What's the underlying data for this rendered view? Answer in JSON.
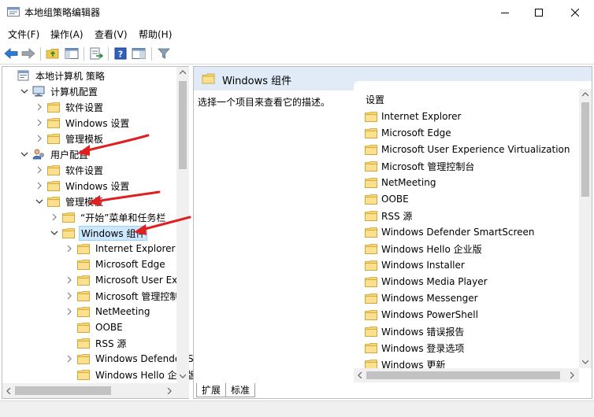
{
  "window": {
    "title": "本地组策略编辑器",
    "minimize_label": "minimize",
    "maximize_label": "maximize",
    "close_label": "close"
  },
  "menu": {
    "items": [
      "文件(F)",
      "操作(A)",
      "查看(V)",
      "帮助(H)"
    ]
  },
  "toolbar": {
    "icons": [
      "back-arrow-icon",
      "forward-arrow-icon",
      "up-folder-icon",
      "show-hide-tree-icon",
      "export-list-icon",
      "help-icon",
      "properties-pane-icon",
      "filter-icon"
    ]
  },
  "tree": {
    "items": [
      {
        "label": "本地计算机 策略",
        "depth": 0,
        "expander": "none",
        "icon": "policy-computer-icon"
      },
      {
        "label": "计算机配置",
        "depth": 1,
        "expander": "expanded",
        "icon": "computer-icon"
      },
      {
        "label": "软件设置",
        "depth": 2,
        "expander": "collapsed",
        "icon": "folder-icon"
      },
      {
        "label": "Windows 设置",
        "depth": 2,
        "expander": "collapsed",
        "icon": "folder-icon"
      },
      {
        "label": "管理模板",
        "depth": 2,
        "expander": "collapsed",
        "icon": "folder-icon"
      },
      {
        "label": "用户配置",
        "depth": 1,
        "expander": "expanded",
        "icon": "user-config-icon"
      },
      {
        "label": "软件设置",
        "depth": 2,
        "expander": "collapsed",
        "icon": "folder-icon"
      },
      {
        "label": "Windows 设置",
        "depth": 2,
        "expander": "collapsed",
        "icon": "folder-icon"
      },
      {
        "label": "管理模板",
        "depth": 2,
        "expander": "expanded",
        "icon": "folder-icon"
      },
      {
        "label": "“开始”菜单和任务栏",
        "depth": 3,
        "expander": "collapsed",
        "icon": "folder-icon"
      },
      {
        "label": "Windows 组件",
        "depth": 3,
        "expander": "expanded",
        "icon": "folder-open-icon",
        "selected": true
      },
      {
        "label": "Internet Explorer",
        "depth": 4,
        "expander": "collapsed",
        "icon": "folder-icon"
      },
      {
        "label": "Microsoft Edge",
        "depth": 4,
        "expander": "none",
        "icon": "folder-icon"
      },
      {
        "label": "Microsoft User Expe",
        "depth": 4,
        "expander": "collapsed",
        "icon": "folder-icon"
      },
      {
        "label": "Microsoft 管理控制台",
        "depth": 4,
        "expander": "collapsed",
        "icon": "folder-icon"
      },
      {
        "label": "NetMeeting",
        "depth": 4,
        "expander": "collapsed",
        "icon": "folder-icon"
      },
      {
        "label": "OOBE",
        "depth": 4,
        "expander": "none",
        "icon": "folder-icon"
      },
      {
        "label": "RSS 源",
        "depth": 4,
        "expander": "none",
        "icon": "folder-icon"
      },
      {
        "label": "Windows Defender S",
        "depth": 4,
        "expander": "collapsed",
        "icon": "folder-icon"
      },
      {
        "label": "Windows Hello 企业版",
        "depth": 4,
        "expander": "none",
        "icon": "folder-icon"
      }
    ]
  },
  "details": {
    "header_title": "Windows 组件",
    "description": "选择一个项目来查看它的描述。",
    "column_header": "设置",
    "items": [
      "Internet Explorer",
      "Microsoft Edge",
      "Microsoft User Experience Virtualization",
      "Microsoft 管理控制台",
      "NetMeeting",
      "OOBE",
      "RSS 源",
      "Windows Defender SmartScreen",
      "Windows Hello 企业版",
      "Windows Installer",
      "Windows Media Player",
      "Windows Messenger",
      "Windows PowerShell",
      "Windows 错误报告",
      "Windows 登录选项",
      "Windows 更新"
    ]
  },
  "tabs": [
    "扩展",
    "标准"
  ],
  "colors": {
    "accent_selection": "#cce8ff",
    "header_band": "#e1ebf7",
    "annotation_arrow": "#e02020",
    "folder_yellow": "#f8d775"
  }
}
